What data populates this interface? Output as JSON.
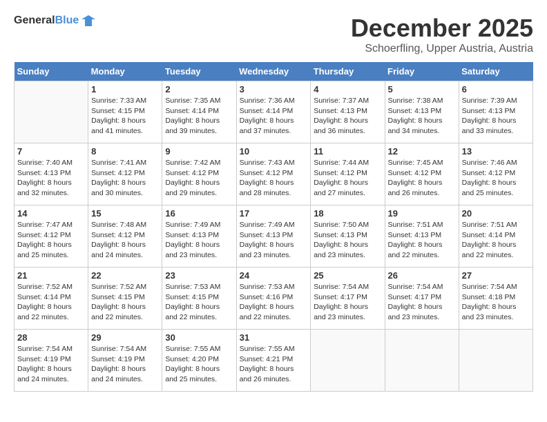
{
  "logo": {
    "general": "General",
    "blue": "Blue"
  },
  "title": {
    "month": "December 2025",
    "location": "Schoerfling, Upper Austria, Austria"
  },
  "headers": [
    "Sunday",
    "Monday",
    "Tuesday",
    "Wednesday",
    "Thursday",
    "Friday",
    "Saturday"
  ],
  "weeks": [
    [
      {
        "day": "",
        "info": ""
      },
      {
        "day": "1",
        "info": "Sunrise: 7:33 AM\nSunset: 4:15 PM\nDaylight: 8 hours\nand 41 minutes."
      },
      {
        "day": "2",
        "info": "Sunrise: 7:35 AM\nSunset: 4:14 PM\nDaylight: 8 hours\nand 39 minutes."
      },
      {
        "day": "3",
        "info": "Sunrise: 7:36 AM\nSunset: 4:14 PM\nDaylight: 8 hours\nand 37 minutes."
      },
      {
        "day": "4",
        "info": "Sunrise: 7:37 AM\nSunset: 4:13 PM\nDaylight: 8 hours\nand 36 minutes."
      },
      {
        "day": "5",
        "info": "Sunrise: 7:38 AM\nSunset: 4:13 PM\nDaylight: 8 hours\nand 34 minutes."
      },
      {
        "day": "6",
        "info": "Sunrise: 7:39 AM\nSunset: 4:13 PM\nDaylight: 8 hours\nand 33 minutes."
      }
    ],
    [
      {
        "day": "7",
        "info": "Sunrise: 7:40 AM\nSunset: 4:13 PM\nDaylight: 8 hours\nand 32 minutes."
      },
      {
        "day": "8",
        "info": "Sunrise: 7:41 AM\nSunset: 4:12 PM\nDaylight: 8 hours\nand 30 minutes."
      },
      {
        "day": "9",
        "info": "Sunrise: 7:42 AM\nSunset: 4:12 PM\nDaylight: 8 hours\nand 29 minutes."
      },
      {
        "day": "10",
        "info": "Sunrise: 7:43 AM\nSunset: 4:12 PM\nDaylight: 8 hours\nand 28 minutes."
      },
      {
        "day": "11",
        "info": "Sunrise: 7:44 AM\nSunset: 4:12 PM\nDaylight: 8 hours\nand 27 minutes."
      },
      {
        "day": "12",
        "info": "Sunrise: 7:45 AM\nSunset: 4:12 PM\nDaylight: 8 hours\nand 26 minutes."
      },
      {
        "day": "13",
        "info": "Sunrise: 7:46 AM\nSunset: 4:12 PM\nDaylight: 8 hours\nand 25 minutes."
      }
    ],
    [
      {
        "day": "14",
        "info": "Sunrise: 7:47 AM\nSunset: 4:12 PM\nDaylight: 8 hours\nand 25 minutes."
      },
      {
        "day": "15",
        "info": "Sunrise: 7:48 AM\nSunset: 4:12 PM\nDaylight: 8 hours\nand 24 minutes."
      },
      {
        "day": "16",
        "info": "Sunrise: 7:49 AM\nSunset: 4:13 PM\nDaylight: 8 hours\nand 23 minutes."
      },
      {
        "day": "17",
        "info": "Sunrise: 7:49 AM\nSunset: 4:13 PM\nDaylight: 8 hours\nand 23 minutes."
      },
      {
        "day": "18",
        "info": "Sunrise: 7:50 AM\nSunset: 4:13 PM\nDaylight: 8 hours\nand 23 minutes."
      },
      {
        "day": "19",
        "info": "Sunrise: 7:51 AM\nSunset: 4:13 PM\nDaylight: 8 hours\nand 22 minutes."
      },
      {
        "day": "20",
        "info": "Sunrise: 7:51 AM\nSunset: 4:14 PM\nDaylight: 8 hours\nand 22 minutes."
      }
    ],
    [
      {
        "day": "21",
        "info": "Sunrise: 7:52 AM\nSunset: 4:14 PM\nDaylight: 8 hours\nand 22 minutes."
      },
      {
        "day": "22",
        "info": "Sunrise: 7:52 AM\nSunset: 4:15 PM\nDaylight: 8 hours\nand 22 minutes."
      },
      {
        "day": "23",
        "info": "Sunrise: 7:53 AM\nSunset: 4:15 PM\nDaylight: 8 hours\nand 22 minutes."
      },
      {
        "day": "24",
        "info": "Sunrise: 7:53 AM\nSunset: 4:16 PM\nDaylight: 8 hours\nand 22 minutes."
      },
      {
        "day": "25",
        "info": "Sunrise: 7:54 AM\nSunset: 4:17 PM\nDaylight: 8 hours\nand 23 minutes."
      },
      {
        "day": "26",
        "info": "Sunrise: 7:54 AM\nSunset: 4:17 PM\nDaylight: 8 hours\nand 23 minutes."
      },
      {
        "day": "27",
        "info": "Sunrise: 7:54 AM\nSunset: 4:18 PM\nDaylight: 8 hours\nand 23 minutes."
      }
    ],
    [
      {
        "day": "28",
        "info": "Sunrise: 7:54 AM\nSunset: 4:19 PM\nDaylight: 8 hours\nand 24 minutes."
      },
      {
        "day": "29",
        "info": "Sunrise: 7:54 AM\nSunset: 4:19 PM\nDaylight: 8 hours\nand 24 minutes."
      },
      {
        "day": "30",
        "info": "Sunrise: 7:55 AM\nSunset: 4:20 PM\nDaylight: 8 hours\nand 25 minutes."
      },
      {
        "day": "31",
        "info": "Sunrise: 7:55 AM\nSunset: 4:21 PM\nDaylight: 8 hours\nand 26 minutes."
      },
      {
        "day": "",
        "info": ""
      },
      {
        "day": "",
        "info": ""
      },
      {
        "day": "",
        "info": ""
      }
    ]
  ]
}
